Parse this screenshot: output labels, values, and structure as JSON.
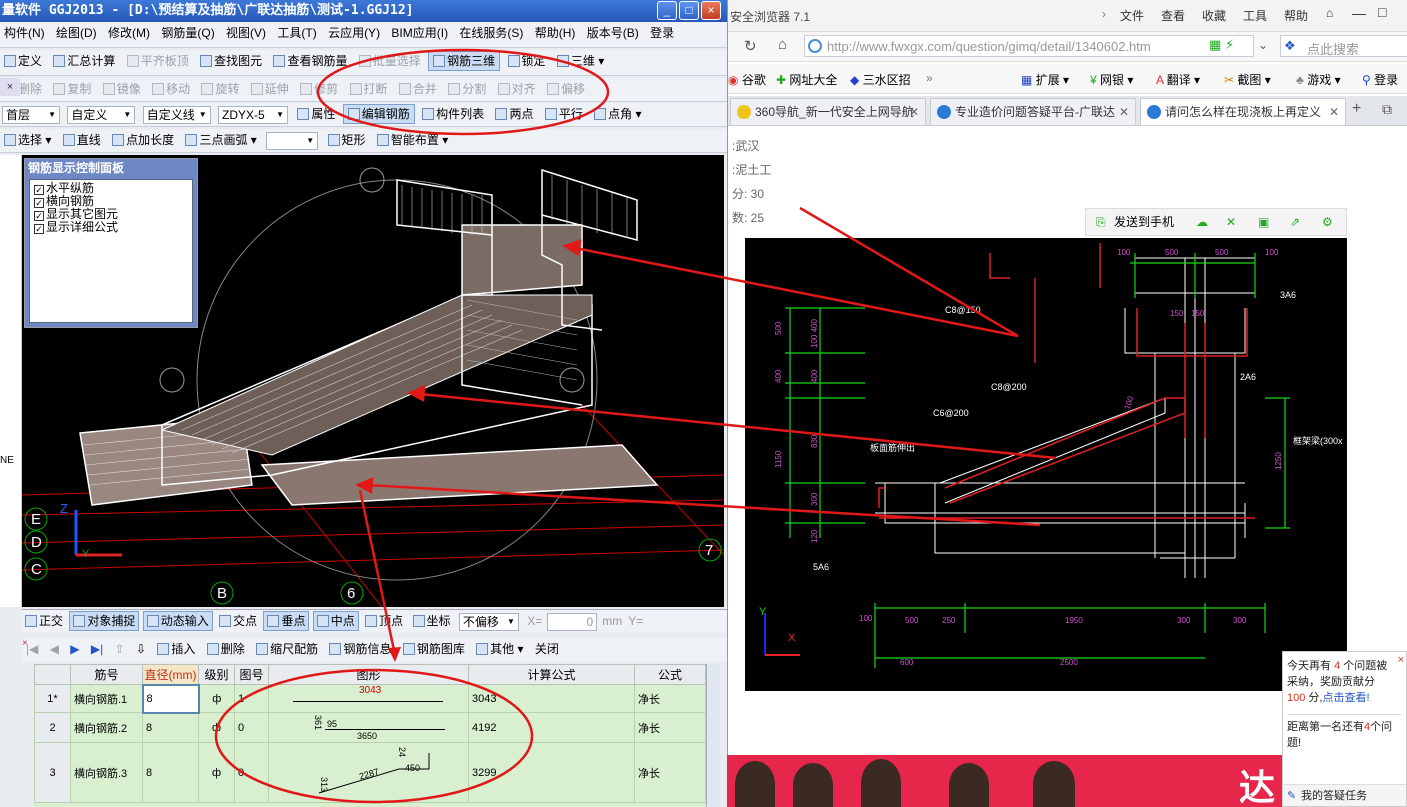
{
  "app": {
    "title": "量软件 GGJ2013 - [D:\\预结算及抽筋\\广联达抽筋\\测试-1.GGJ12]",
    "menu": [
      "构件(N)",
      "绘图(D)",
      "修改(M)",
      "钢筋量(Q)",
      "视图(V)",
      "工具(T)",
      "云应用(Y)",
      "BIM应用(I)",
      "在线服务(S)",
      "帮助(H)",
      "版本号(B)"
    ],
    "login": "登录",
    "toolbar1": [
      "定义",
      "汇总计算",
      "平齐板顶",
      "查找图元",
      "查看钢筋量",
      "批量选择",
      "钢筋三维",
      "锁定",
      "三维"
    ],
    "toolbar2": [
      "删除",
      "复制",
      "镜像",
      "移动",
      "旋转",
      "延伸",
      "修剪",
      "打断",
      "合并",
      "分割",
      "对齐",
      "偏移"
    ],
    "toolbar3": {
      "floor": "首层",
      "type": "自定义",
      "line": "自定义线",
      "component": "ZDYX-5",
      "items": [
        "属性",
        "编辑钢筋",
        "构件列表",
        "两点",
        "平行",
        "点角"
      ]
    },
    "toolbar4": [
      "选择",
      "直线",
      "点加长度",
      "三点画弧",
      "矩形",
      "智能布置"
    ],
    "control_panel": {
      "title": "钢筋显示控制面板",
      "options": [
        "水平纵筋",
        "横向钢筋",
        "显示其它图元",
        "显示详细公式"
      ]
    },
    "axis_labels": [
      "E",
      "D",
      "C",
      "B",
      "6",
      "7"
    ],
    "axis_names": [
      "Z",
      "Y"
    ],
    "left_marker": "NE",
    "snap_bar": [
      "正交",
      "对象捕捉",
      "动态输入",
      "交点",
      "垂点",
      "中点",
      "顶点",
      "坐标",
      "不偏移"
    ],
    "snap_inputs": {
      "x_label": "X=",
      "x_value": "0",
      "unit": "mm",
      "y_label": "Y="
    },
    "grid_bar": [
      "插入",
      "删除",
      "缩尺配筋",
      "钢筋信息",
      "钢筋图库",
      "其他",
      "关闭"
    ],
    "grid": {
      "headers": [
        "筋号",
        "直径(mm)",
        "级别",
        "图号",
        "图形",
        "计算公式",
        "公式"
      ],
      "rows": [
        {
          "num": "1*",
          "name": "横向钢筋.1",
          "dia": "8",
          "grade": "ф",
          "fig": "1",
          "shape_len": "3043",
          "formula": "3043",
          "desc": "净长"
        },
        {
          "num": "2",
          "name": "横向钢筋.2",
          "dia": "8",
          "grade": "ф",
          "fig": "0",
          "shape_len": "3650",
          "shape_a": "361",
          "shape_b": "95",
          "formula": "4192",
          "desc": "净长"
        },
        {
          "num": "3",
          "name": "横向钢筋.3",
          "dia": "8",
          "grade": "ф",
          "fig": "0",
          "shape_len": "2287",
          "shape_a": "313",
          "shape_b": "450",
          "shape_c": "24",
          "formula": "3299",
          "desc": "净长"
        }
      ]
    }
  },
  "browser": {
    "title": "安全浏览器 7.1",
    "menu": [
      "文件",
      "查看",
      "收藏",
      "工具",
      "帮助"
    ],
    "url": "http://www.fwxgx.com/question/gimq/detail/1340602.htm",
    "search_placeholder": "点此搜索",
    "bookmarks": [
      "谷歌",
      "网址大全",
      "三水区招",
      "扩展",
      "网银",
      "翻译",
      "截图",
      "游戏",
      "登录"
    ],
    "tabs": [
      "360导航_新一代安全上网导航",
      "专业造价问题答疑平台-广联达",
      "请问怎么样在现浇板上再定义"
    ],
    "info": [
      ":武汉",
      ":泥土工",
      "分: 30",
      "数: 25"
    ],
    "cad_tools": [
      "发送到手机"
    ],
    "cad_labels": {
      "c8_150": "C8@150",
      "c8_200": "C8@200",
      "c6_200": "C6@200",
      "board": "板面筋伸出",
      "a6_3": "3A6",
      "a6_2": "2A6",
      "a6_5": "5A6",
      "beam": "框架梁(300x",
      "d100a": "100",
      "d500a": "500",
      "d500b": "500",
      "d100b": "100",
      "d150": "150",
      "d150b": "150",
      "v500": "500",
      "v100400": "100 400",
      "v400": "400",
      "v1150": "1150",
      "v830": "830",
      "v300": "300",
      "v120": "120",
      "v1250": "1250",
      "v100": "100",
      "b100": "100",
      "b500": "500",
      "b250": "250",
      "b1950": "1950",
      "b300a": "300",
      "b300b": "300",
      "b600": "600",
      "b2500": "2500",
      "axis_y": "Y",
      "axis_x": "X"
    },
    "popup": {
      "line1a": "今天再有",
      "count": "4",
      "line1b": "个问题被采纳，奖励贡献分",
      "points": "100",
      "line2": "分,",
      "link": "点击查看!",
      "line3": "距离第一名还有",
      "count2": "4",
      "line4": "个问题!",
      "task": "我的答疑任务"
    }
  }
}
